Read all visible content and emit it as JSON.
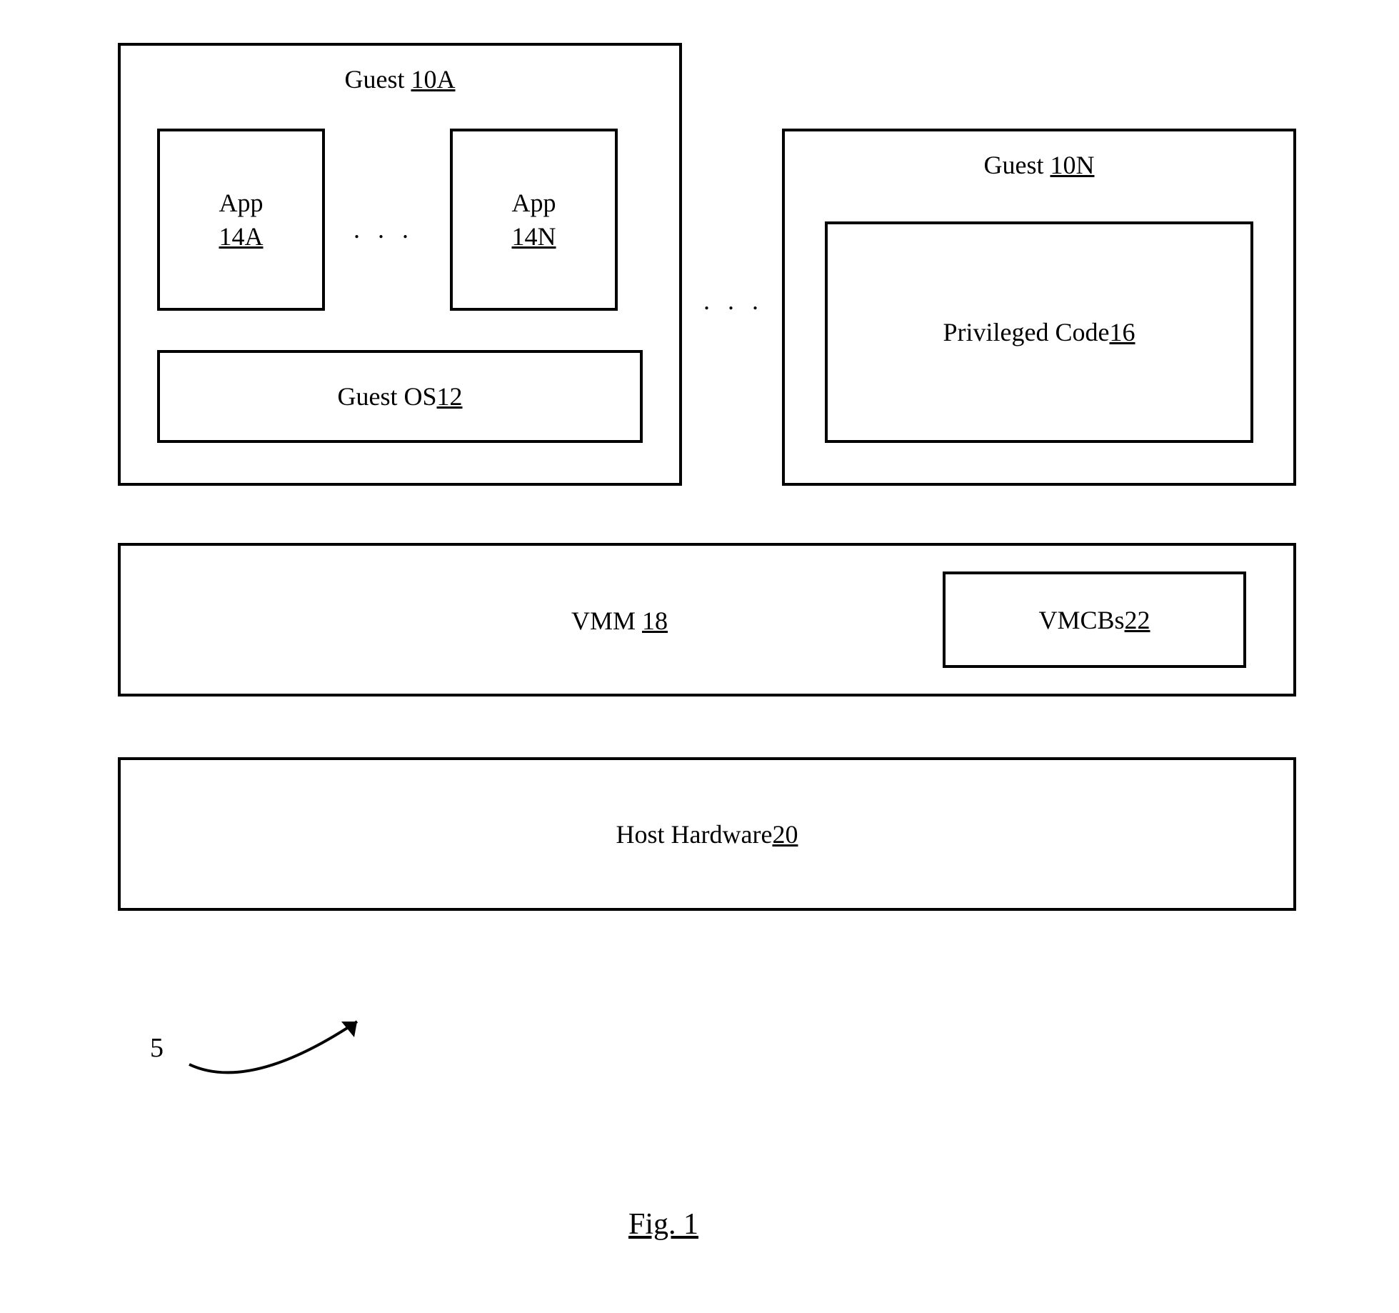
{
  "guestA": {
    "title_prefix": "Guest ",
    "title_ref": "10A",
    "app1": {
      "label": "App",
      "ref": "14A"
    },
    "appN": {
      "label": "App",
      "ref": "14N"
    },
    "ellipsis_apps": ". . .",
    "guestOS": {
      "label": "Guest OS ",
      "ref": "12"
    }
  },
  "ellipsis_guests": ". . .",
  "guestN": {
    "title_prefix": "Guest ",
    "title_ref": "10N",
    "priv": {
      "label": "Privileged Code ",
      "ref": "16"
    }
  },
  "vmm": {
    "label": "VMM ",
    "ref": "18",
    "vmcbs": {
      "label": "VMCBs ",
      "ref": "22"
    }
  },
  "hostHW": {
    "label": "Host Hardware ",
    "ref": "20"
  },
  "refnum5": "5",
  "figLabel": "Fig. 1"
}
